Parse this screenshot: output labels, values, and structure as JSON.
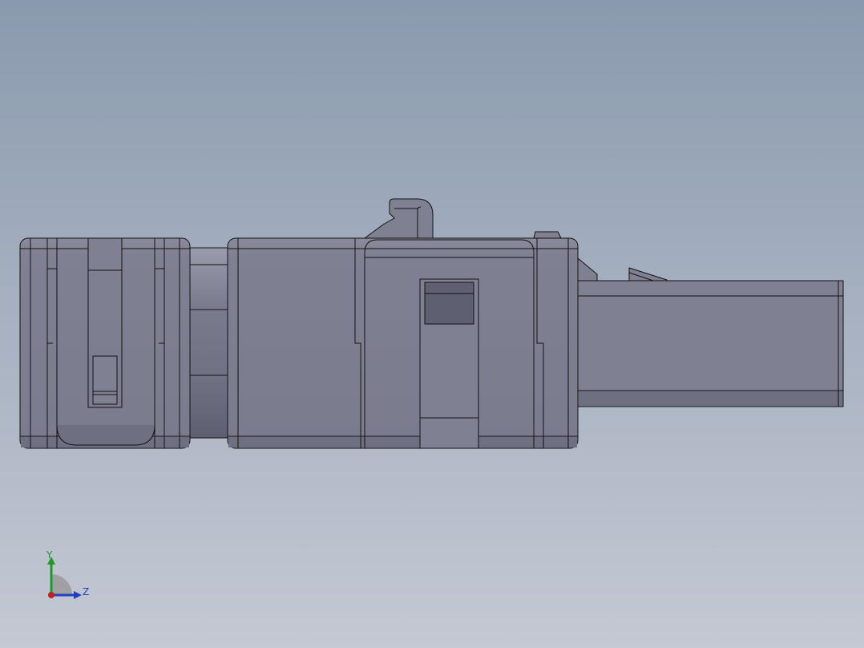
{
  "viewport": {
    "background_top": "#8a9aae",
    "background_bottom": "#c4c9d3"
  },
  "model": {
    "body_color": "#7d7f91",
    "edge_color": "#111111"
  },
  "triad": {
    "y_label": "Y",
    "z_label": "Z",
    "y_color": "#1e9a2a",
    "z_color": "#2040c0",
    "x_color": "#c02020"
  }
}
